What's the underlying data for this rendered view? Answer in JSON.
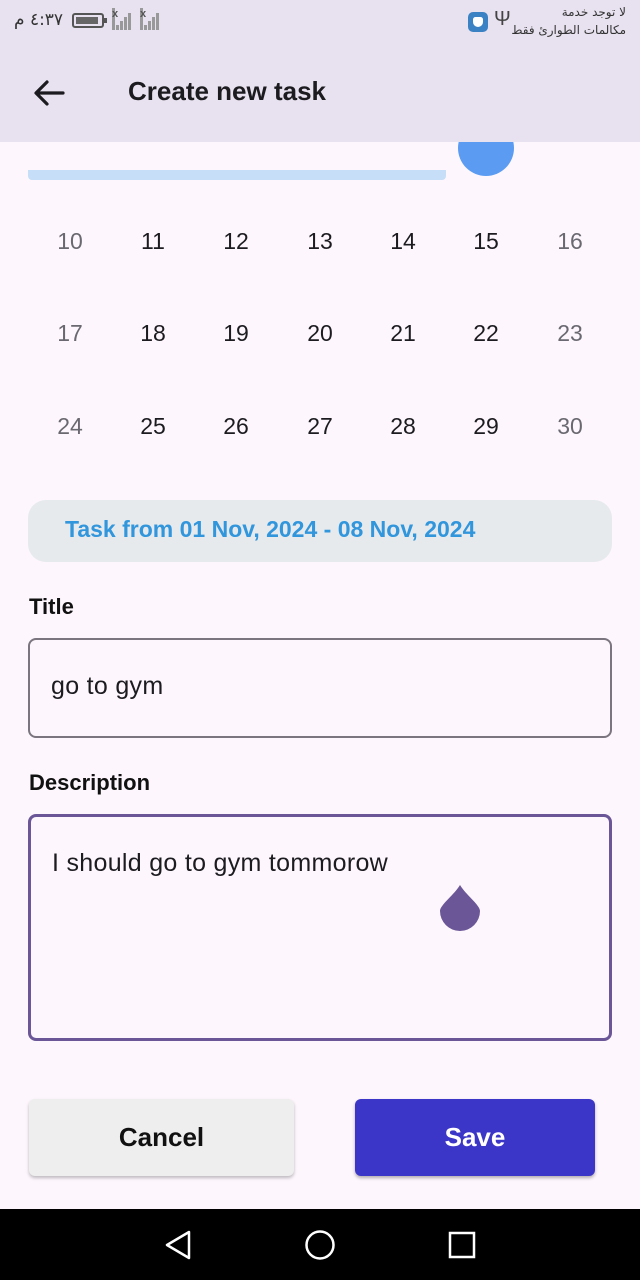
{
  "status_bar": {
    "time": "٤:٣٧ م",
    "carrier_line1": "لا توجد خدمة",
    "carrier_line2": "مكالمات الطوارئ فقط"
  },
  "app_bar": {
    "title": "Create new task",
    "back_icon": "arrow-left-icon"
  },
  "calendar": {
    "weeks": [
      [
        "10",
        "11",
        "12",
        "13",
        "14",
        "15",
        "16"
      ],
      [
        "17",
        "18",
        "19",
        "20",
        "21",
        "22",
        "23"
      ],
      [
        "24",
        "25",
        "26",
        "27",
        "28",
        "29",
        "30"
      ]
    ],
    "range_color": "#c6def7",
    "range_end_color": "#5b9cf2"
  },
  "range_badge": "Task from 01 Nov, 2024 - 08 Nov, 2024",
  "form": {
    "title_label": "Title",
    "title_value": "go to gym",
    "description_label": "Description",
    "description_value": "I should go to gym tommorow"
  },
  "actions": {
    "cancel_label": "Cancel",
    "save_label": "Save"
  },
  "colors": {
    "accent": "#3c36c8",
    "badge_text": "#3196dc",
    "focus_border": "#6b5697"
  },
  "nav": {
    "back": "triangle-back-icon",
    "home": "circle-home-icon",
    "recents": "square-recents-icon"
  }
}
